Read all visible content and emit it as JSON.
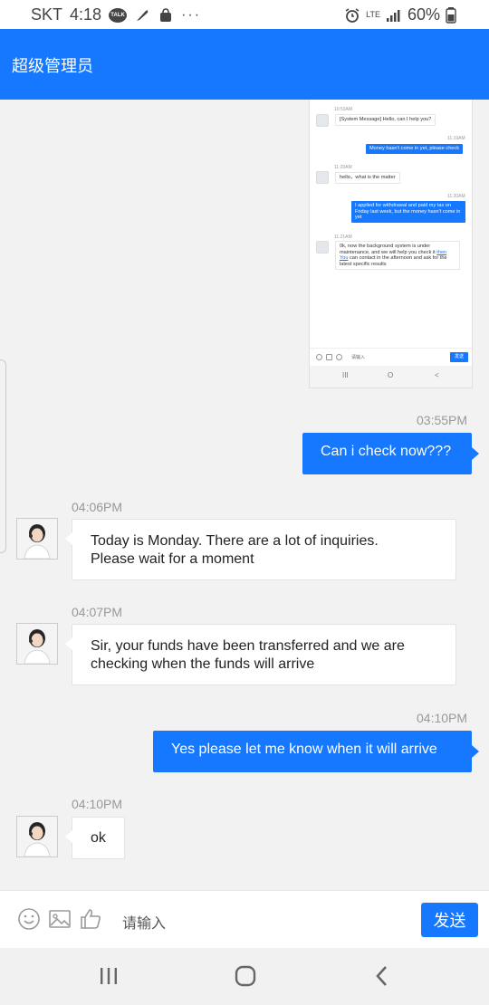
{
  "status_bar": {
    "carrier": "SKT",
    "time": "4:18",
    "talk_badge": "TALK",
    "more": "···",
    "network": "LTE",
    "battery": "60%"
  },
  "header": {
    "title": "超级管理员"
  },
  "embedded_screenshot": {
    "messages": [
      {
        "side": "left",
        "time": "10:53AM",
        "text": "[System Message] Hello, can I help you?"
      },
      {
        "side": "right",
        "time": "11:19AM",
        "text": "Money hasn't come in yet, please check"
      },
      {
        "side": "left",
        "time": "11:20AM",
        "text": "hello，what is the matter"
      },
      {
        "side": "right",
        "time": "11:20AM",
        "text": "I applied for withdrawal and paid my tax on Friday last week, but the money hasn't come in yet"
      },
      {
        "side": "left",
        "time": "11:21AM",
        "text_a": "0k, now the background system is under maintenance, and we will help you check it",
        "text_link": "then You",
        "text_b": " can contact in the afternoon and ask for the latest specific results"
      }
    ],
    "input_placeholder": "请输入",
    "send_label": "发送",
    "nav": [
      "III",
      "O",
      "<"
    ]
  },
  "messages": [
    {
      "side": "right",
      "time": "03:55PM",
      "text": "Can i check now???"
    },
    {
      "side": "left",
      "time": "04:06PM",
      "lines": [
        "Today is Monday. There are a lot of inquiries.",
        "Please wait for a moment"
      ]
    },
    {
      "side": "left",
      "time": "04:07PM",
      "lines": [
        "Sir, your funds have been transferred and we are",
        "checking when the funds will arrive"
      ]
    },
    {
      "side": "right",
      "time": "04:10PM",
      "text": "Yes please let me know when it will arrive"
    },
    {
      "side": "left",
      "time": "04:10PM",
      "text": "ok"
    }
  ],
  "input_bar": {
    "placeholder": "请输入",
    "send_label": "发送",
    "icons": [
      "emoji-icon",
      "image-icon",
      "thumbs-up-icon"
    ]
  },
  "nav_bar": {
    "icons": [
      "recent-apps-icon",
      "home-icon",
      "back-icon"
    ]
  },
  "colors": {
    "accent": "#1677ff",
    "background": "#f2f2f2",
    "timestamp": "#999999"
  }
}
